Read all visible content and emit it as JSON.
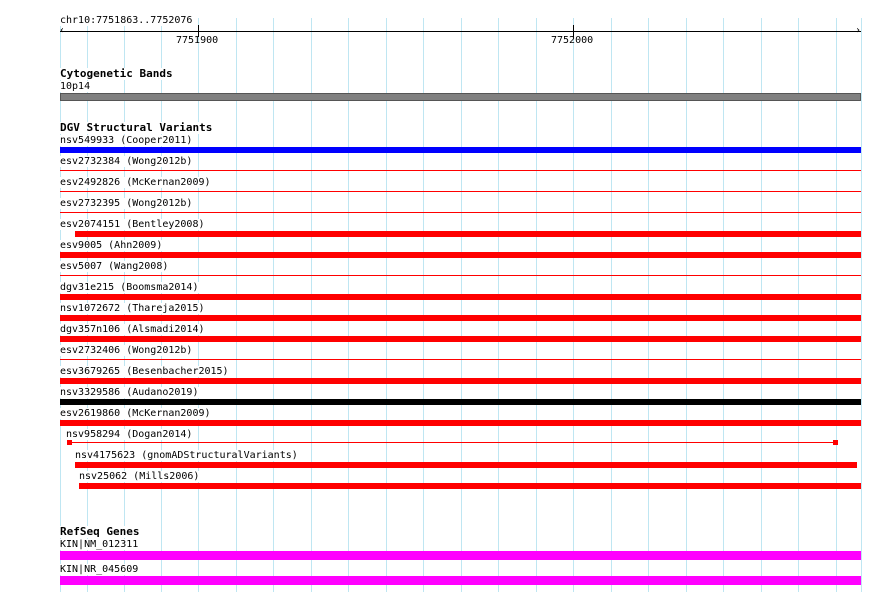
{
  "ruler": {
    "range": "chr10:7751863..7752076",
    "tick_labels": [
      "7751900",
      "7752000"
    ]
  },
  "tracks": {
    "cyto": {
      "title": "Cytogenetic Bands",
      "band": "10p14"
    },
    "dgv": {
      "title": "DGV Structural Variants",
      "features": [
        "nsv549933 (Cooper2011)",
        "esv2732384 (Wong2012b)",
        "esv2492826 (McKernan2009)",
        "esv2732395 (Wong2012b)",
        "esv2074151 (Bentley2008)",
        "esv9005 (Ahn2009)",
        "esv5007 (Wang2008)",
        "dgv31e215 (Boomsma2014)",
        "nsv1072672 (Thareja2015)",
        "dgv357n106 (Alsmadi2014)",
        "esv2732406 (Wong2012b)",
        "esv3679265 (Besenbacher2015)",
        "nsv3329586 (Audano2019)",
        "esv2619860 (McKernan2009)",
        "nsv958294 (Dogan2014)",
        "nsv4175623 (gnomADStructuralVariants)",
        "nsv25062 (Mills2006)"
      ]
    },
    "refseq": {
      "title": "RefSeq Genes",
      "features": [
        "KIN|NM_012311",
        "KIN|NR_045609"
      ]
    }
  },
  "colors": {
    "grid": "#bfe6f2",
    "cyto_band": "#808080",
    "dgv_gain": "#0000ff",
    "dgv_loss": "#ff0000",
    "dgv_complex": "#000000",
    "refseq": "#ff00ff"
  }
}
